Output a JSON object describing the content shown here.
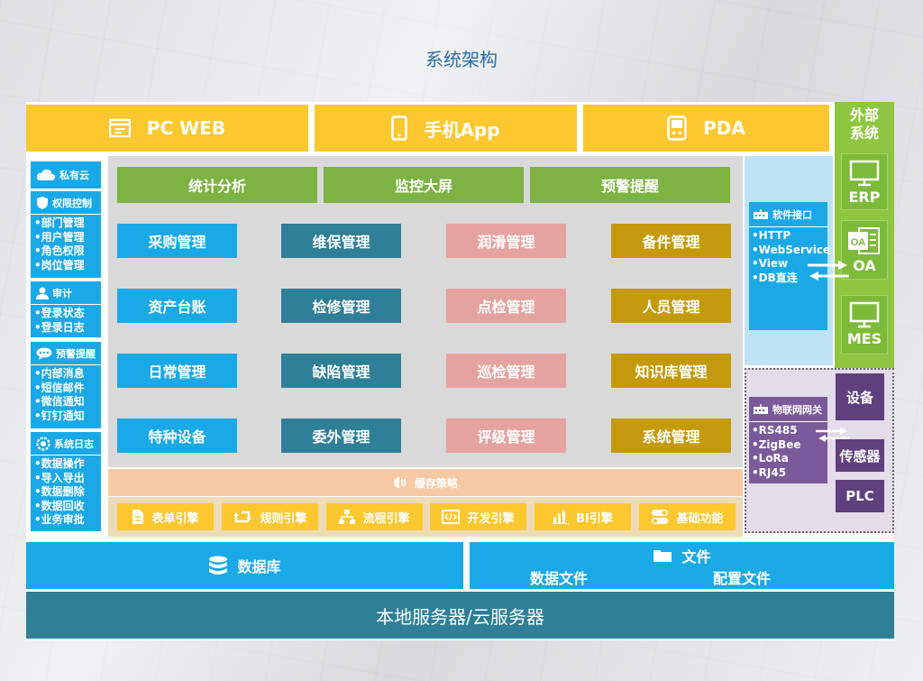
{
  "title": "系统架构",
  "clients": [
    {
      "label": "PC WEB",
      "icon": "browser-window-icon"
    },
    {
      "label": "手机App",
      "icon": "mobile-phone-icon"
    },
    {
      "label": "PDA",
      "icon": "pda-device-icon"
    }
  ],
  "external": {
    "title_line1": "外部",
    "title_line2": "系统",
    "items": [
      "ERP",
      "OA",
      "MES"
    ]
  },
  "sidebar": {
    "sections": [
      {
        "title": "私有云",
        "icon": "cloud-icon",
        "items": []
      },
      {
        "title": "权限控制",
        "icon": "shield-icon",
        "items": [
          "•部门管理",
          "•用户管理",
          "•角色权限",
          "•岗位管理"
        ]
      },
      {
        "title": "审计",
        "icon": "user-icon",
        "items": [
          "•登录状态",
          "•登录日志"
        ]
      },
      {
        "title": "预警提醒",
        "icon": "chat-bubble-icon",
        "items": [
          "•内部消息",
          "•短信邮件",
          "•微信通知",
          "•钉钉通知"
        ]
      },
      {
        "title": "系统日志",
        "icon": "gear-icon",
        "items": [
          "•数据操作",
          "•导入导出",
          "•数据删除",
          "•数据回收",
          "•业务审批"
        ]
      }
    ]
  },
  "top_modules": [
    "统计分析",
    "监控大屏",
    "预警提醒"
  ],
  "modules": [
    [
      "采购管理",
      "维保管理",
      "润滑管理",
      "备件管理"
    ],
    [
      "资产台账",
      "检修管理",
      "点检管理",
      "人员管理"
    ],
    [
      "日常管理",
      "缺陷管理",
      "巡检管理",
      "知识库管理"
    ],
    [
      "特种设备",
      "委外管理",
      "评级管理",
      "系统管理"
    ]
  ],
  "cache_label": "缓存策略",
  "engines": [
    {
      "label": "表单引擎",
      "icon": "document-icon"
    },
    {
      "label": "规则引擎",
      "icon": "cycle-arrows-icon"
    },
    {
      "label": "流程引擎",
      "icon": "hierarchy-icon"
    },
    {
      "label": "开发引擎",
      "icon": "code-icon"
    },
    {
      "label": "BI引擎",
      "icon": "bar-chart-icon"
    },
    {
      "label": "基础功能",
      "icon": "toggle-icon"
    }
  ],
  "interface": {
    "title": "软件接口",
    "items": [
      "•HTTP",
      "•WebService",
      "•View",
      "•DB直连"
    ]
  },
  "iot": {
    "title": "物联网网关",
    "items": [
      "•RS485",
      "•ZigBee",
      "•LoRa",
      "•RJ45"
    ],
    "devices": [
      "设备",
      "传感器",
      "PLC"
    ]
  },
  "database": "数据库",
  "files": {
    "title": "文件",
    "items": [
      "数据文件",
      "配置文件"
    ]
  },
  "server": "本地服务器/云服务器",
  "colors": {
    "yellow": "#fcc72f",
    "blue": "#1aa9e6",
    "teal": "#2e7f97",
    "pink": "#e5a3a0",
    "gold": "#c49a0c",
    "green": "#7cb342",
    "purple": "#7b5a9b"
  }
}
